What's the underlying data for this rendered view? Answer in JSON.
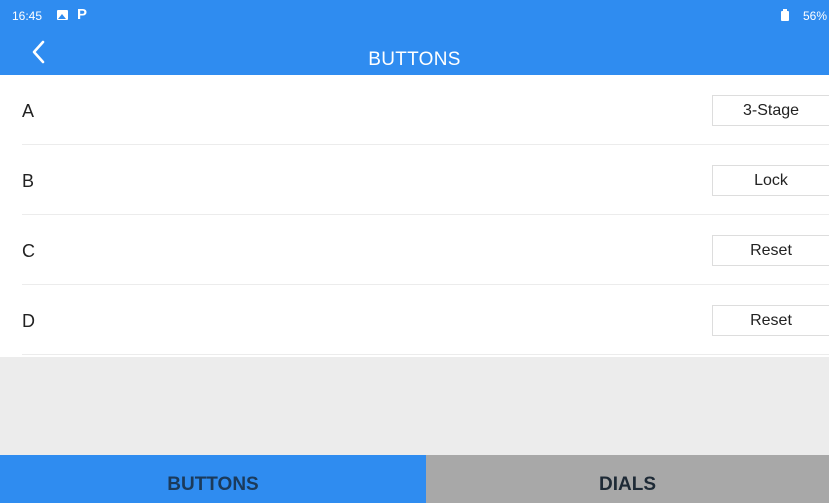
{
  "status_bar": {
    "time": "16:45",
    "battery": "56%"
  },
  "header": {
    "title": "BUTTONS"
  },
  "rows": [
    {
      "label": "A",
      "value": "3-Stage"
    },
    {
      "label": "B",
      "value": "Lock"
    },
    {
      "label": "C",
      "value": "Reset"
    },
    {
      "label": "D",
      "value": "Reset"
    }
  ],
  "tabs": {
    "buttons": "BUTTONS",
    "dials": "DIALS"
  },
  "colors": {
    "accent": "#2f8cf0",
    "inactive_tab": "#a8a8a8",
    "background": "#ececec"
  }
}
